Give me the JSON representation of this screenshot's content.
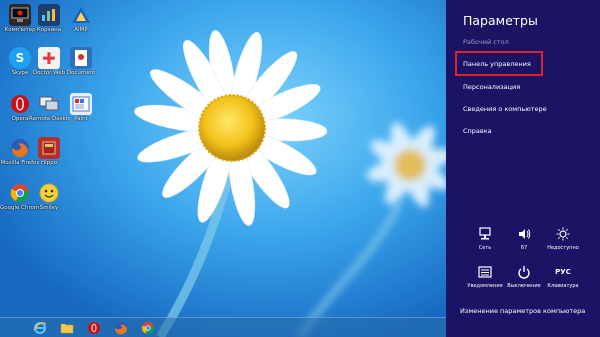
{
  "desktop": {
    "icons": [
      {
        "label": "Комп'ютер",
        "icon": "computer-icon",
        "color": "#2a2a2a"
      },
      {
        "label": "Корзина",
        "icon": "recycle-bin-icon",
        "color": "#3a3a3a"
      },
      {
        "label": "Opera",
        "icon": "opera-icon",
        "color": "#cc0f16"
      },
      {
        "label": "Mozilla Firefox",
        "icon": "firefox-icon",
        "color": "#e8761c"
      },
      {
        "label": "Google Chrome",
        "icon": "chrome-icon",
        "color": "#3e8e3e"
      },
      {
        "label": "Skype",
        "icon": "skype-icon",
        "color": "#1ea1f2"
      },
      {
        "label": "Doctor Web",
        "icon": "antivirus-icon",
        "color": "#e23a3a"
      },
      {
        "label": "Remote Desktop",
        "icon": "remote-desktop-icon",
        "color": "#7a8fa6"
      },
      {
        "label": "Hippo",
        "icon": "book-icon",
        "color": "#b23030"
      },
      {
        "label": "Smiley",
        "icon": "smiley-icon",
        "color": "#e6b617"
      },
      {
        "label": "AIMP",
        "icon": "aimp-icon",
        "color": "#1e5fb8"
      },
      {
        "label": "Document",
        "icon": "document-icon",
        "color": "#2f6fc0"
      },
      {
        "label": "Paint",
        "icon": "paint-icon",
        "color": "#3a7bd5"
      }
    ]
  },
  "taskbar": {
    "items": [
      "internet-explorer-icon",
      "file-explorer-icon",
      "opera-icon",
      "firefox-icon",
      "chrome-icon"
    ]
  },
  "settings": {
    "title": "Параметры",
    "subtitle": "Рабочий стол",
    "menu": [
      "Панель управления",
      "Персонализация",
      "Сведения о компьютере",
      "Справка"
    ],
    "quick": [
      {
        "label": "Сеть",
        "icon": "network-icon"
      },
      {
        "label": "67",
        "icon": "volume-icon"
      },
      {
        "label": "Недоступно",
        "icon": "brightness-icon"
      },
      {
        "label": "Уведомления",
        "icon": "notifications-icon"
      },
      {
        "label": "Выключение",
        "icon": "power-icon"
      },
      {
        "label": "Клавиатура",
        "icon": "keyboard-icon",
        "glyph": "РУС"
      }
    ],
    "change_link": "Изменение параметров компьютера",
    "colors": {
      "panel": "#1b1464",
      "highlight": "#e0202a",
      "subtitle": "#9b97c6"
    }
  }
}
